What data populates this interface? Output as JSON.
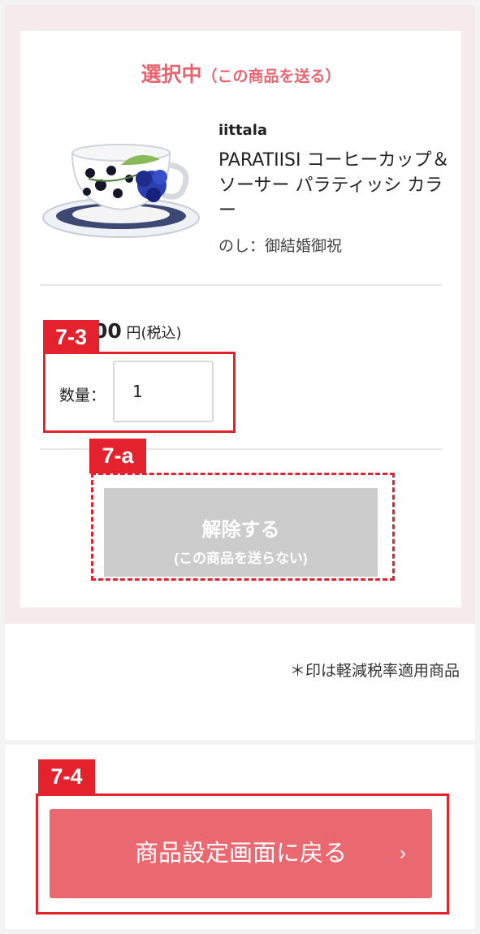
{
  "selection": {
    "heading_main": "選択中",
    "heading_sub": "（この商品を送る）"
  },
  "product": {
    "brand": "iittala",
    "name": "PARATIISI コーヒーカップ＆ソーサー パラティッシ カラー",
    "noshi": "のし：御結婚御祝",
    "price_amount": "00",
    "price_unit": "円(税込)",
    "quantity_label": "数量：",
    "quantity_value": "1"
  },
  "remove_button": {
    "main": "解除する",
    "sub": "(この商品を送らない)"
  },
  "note": "＊印は軽減税率適用商品",
  "back_button": {
    "label": "商品設定画面に戻る",
    "chevron": "›"
  },
  "annotations": {
    "tag_quantity": "7-3",
    "tag_remove": "7-a",
    "tag_back": "7-4"
  },
  "colors": {
    "accent": "#e86570",
    "annotation_red": "#e4222e",
    "disabled_gray": "#cccccc",
    "button_pink": "#ea6870",
    "selected_bg": "#f7eaec"
  }
}
